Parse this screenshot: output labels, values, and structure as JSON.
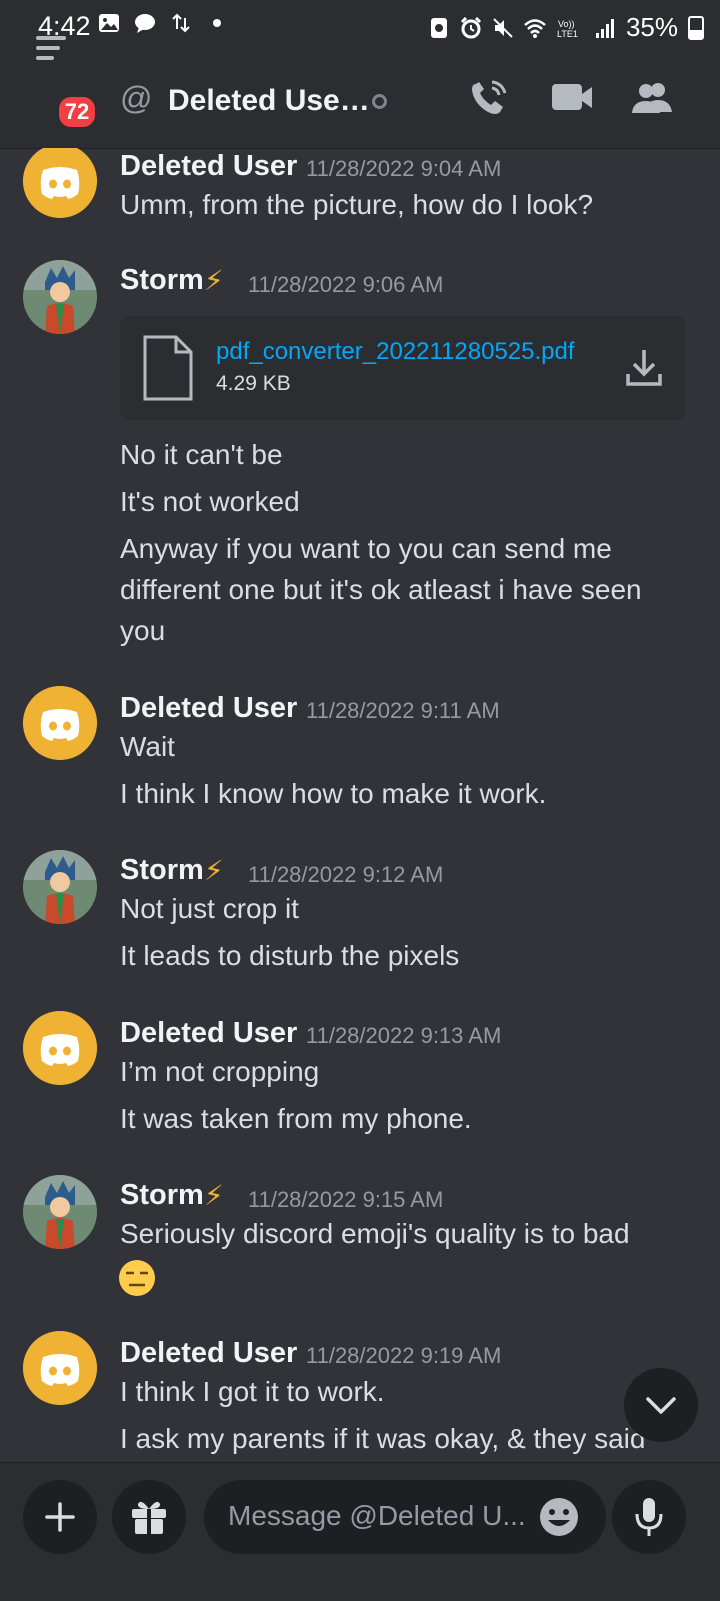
{
  "status_bar": {
    "time": "4:42",
    "battery": "35%",
    "left_icons": [
      "image-icon",
      "chat-icon",
      "data-transfer-icon",
      "dot-icon"
    ],
    "right_icons": [
      "nfc-icon",
      "alarm-icon",
      "mute-icon",
      "wifi-icon",
      "volte-icon",
      "signal-icon",
      "battery-icon"
    ]
  },
  "header": {
    "menu_badge": "72",
    "title": "Deleted Use…",
    "icons": [
      "call-icon",
      "video-icon",
      "members-icon"
    ]
  },
  "messages": [
    {
      "author": "Deleted User",
      "timestamp": "11/28/2022 9:04 AM",
      "lines": [
        "Umm, from the picture, how do I look?"
      ]
    },
    {
      "author": "Storm",
      "author_emoji": "⚡",
      "timestamp": "11/28/2022 9:06 AM",
      "attachment": {
        "name": "pdf_converter_202211280525.pdf",
        "size": "4.29 KB"
      },
      "lines": [
        "No it can't be",
        "It's not worked",
        "Anyway if you want to you can send me",
        "different one but it's ok atleast i have seen",
        "you"
      ]
    },
    {
      "author": "Deleted User",
      "timestamp": "11/28/2022 9:11 AM",
      "lines": [
        "Wait",
        "I think I know how to make it work."
      ]
    },
    {
      "author": "Storm",
      "author_emoji": "⚡",
      "timestamp": "11/28/2022 9:12 AM",
      "lines": [
        "Not just crop it",
        "It leads to disturb the pixels"
      ]
    },
    {
      "author": "Deleted User",
      "timestamp": "11/28/2022 9:13 AM",
      "lines": [
        "I’m not cropping",
        "It was taken from my phone."
      ]
    },
    {
      "author": "Storm",
      "author_emoji": "⚡",
      "timestamp": "11/28/2022 9:15 AM",
      "lines": [
        "Seriously discord emoji's quality is to bad"
      ],
      "emoji": "😑"
    },
    {
      "author": "Deleted User",
      "timestamp": "11/28/2022 9:19 AM",
      "lines": [
        "I think I got it to work.",
        "I ask my parents if it was okay, & they said"
      ]
    }
  ],
  "composer": {
    "placeholder": "Message @Deleted U..."
  },
  "colors": {
    "background": "#313338",
    "header": "#2b2d31",
    "link": "#00a8fc",
    "discord_avatar": "#f0b232",
    "badge": "#f23f43"
  }
}
